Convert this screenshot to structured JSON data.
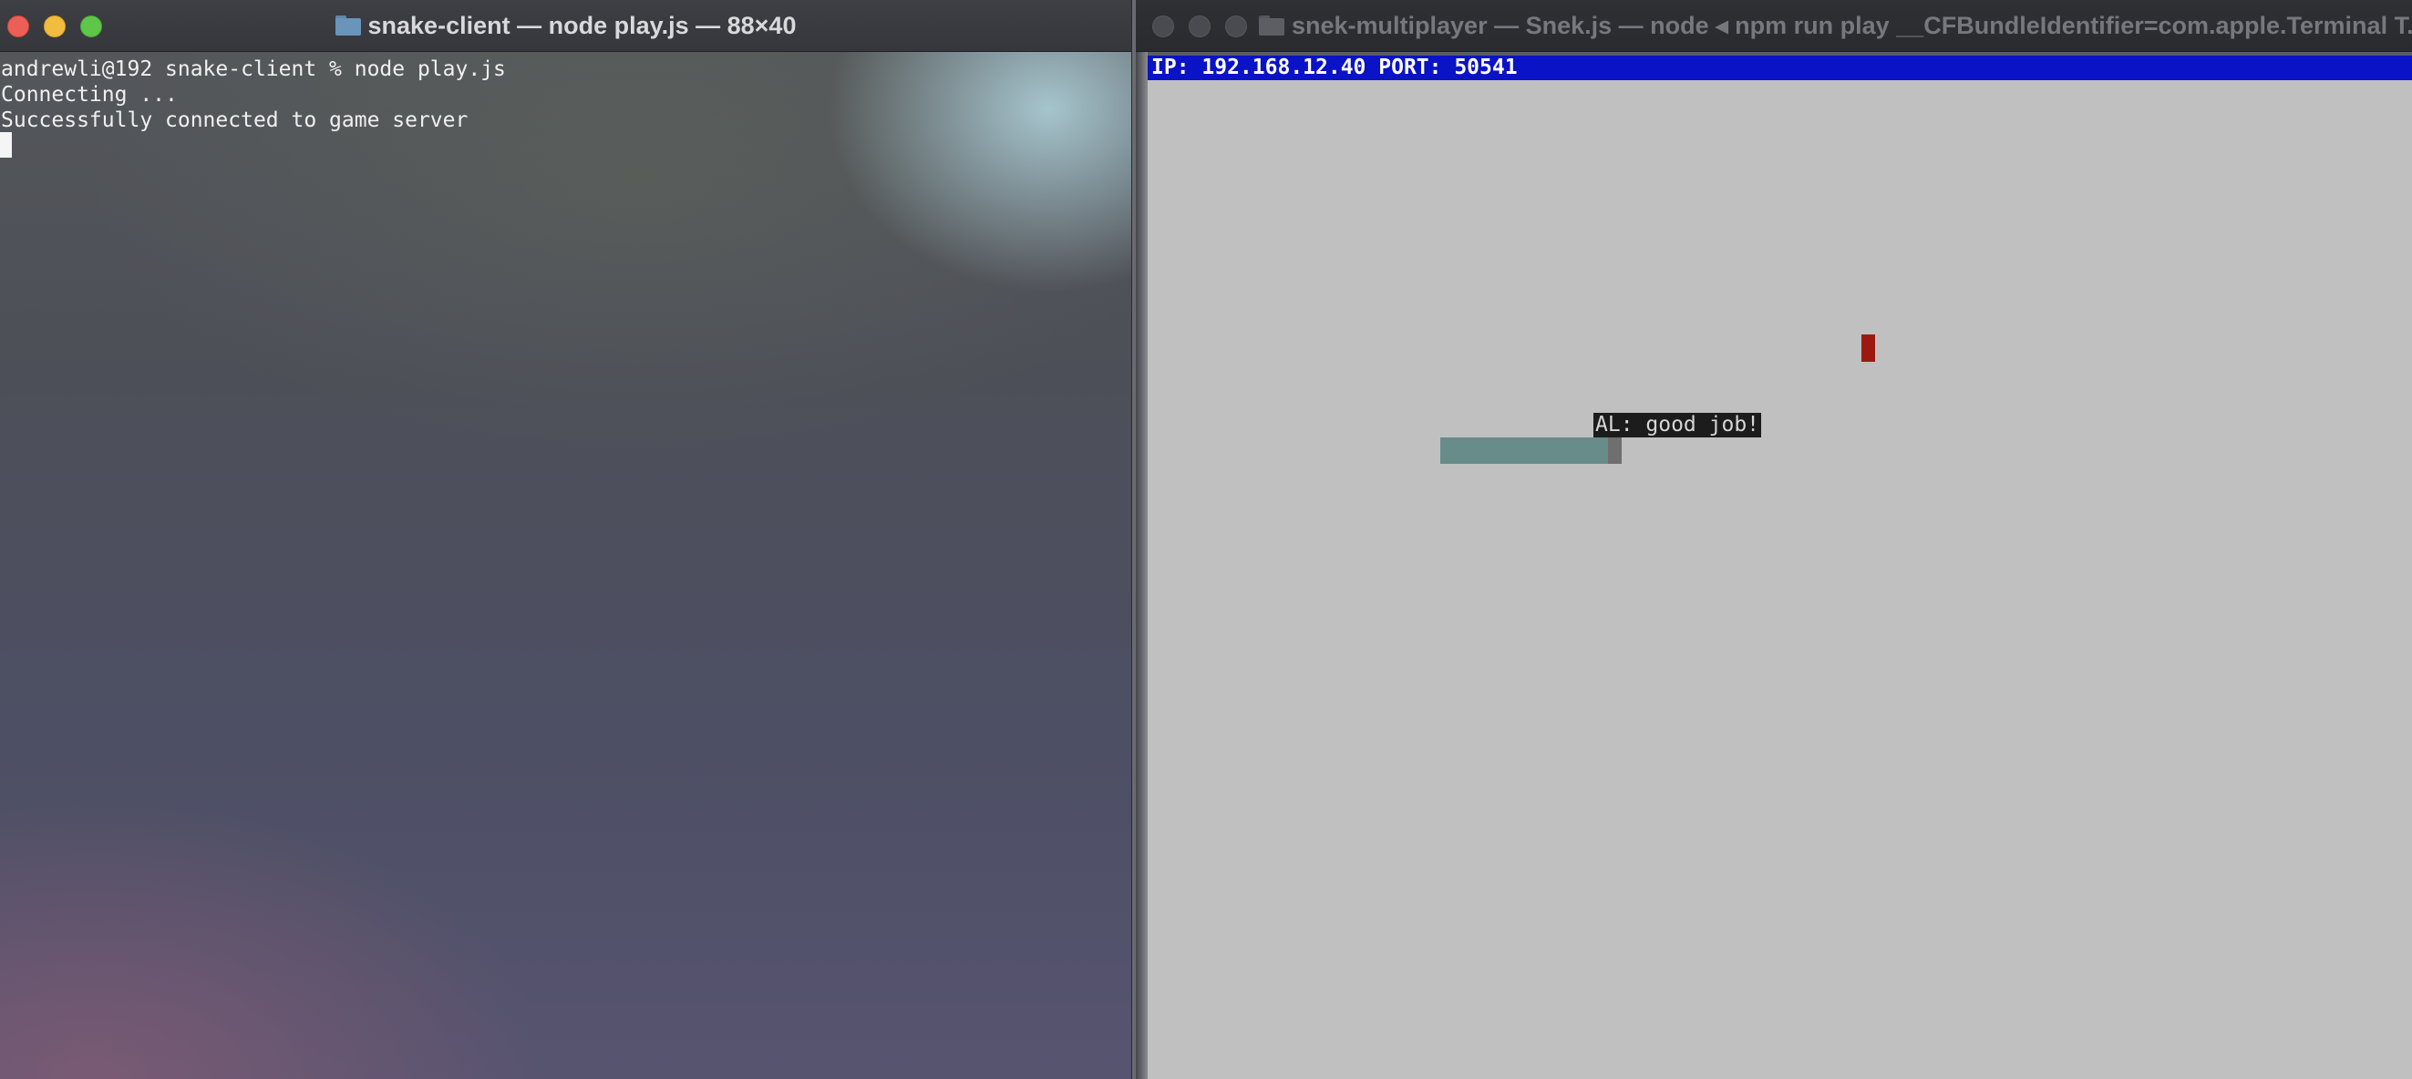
{
  "left_window": {
    "title": "snake-client — node play.js — 88×40",
    "icon": "folder-icon",
    "lines": [
      "andrewli@192 snake-client % node play.js",
      "Connecting ...",
      "Successfully connected to game server"
    ]
  },
  "right_window": {
    "title": "snek-multiplayer — Snek.js — node ◂ npm run play __CFBundleIdentifier=com.apple.Terminal T...",
    "icon": "folder-icon",
    "status_bar": "IP: 192.168.12.40 PORT: 50541",
    "chat_message": "AL: good job!",
    "colors": {
      "status_bar": "#0a13c6",
      "board": "#c0c0c0",
      "food": "#9b1a10",
      "snake_body": "#678c8a",
      "snake_head": "#6f6f6f"
    }
  }
}
